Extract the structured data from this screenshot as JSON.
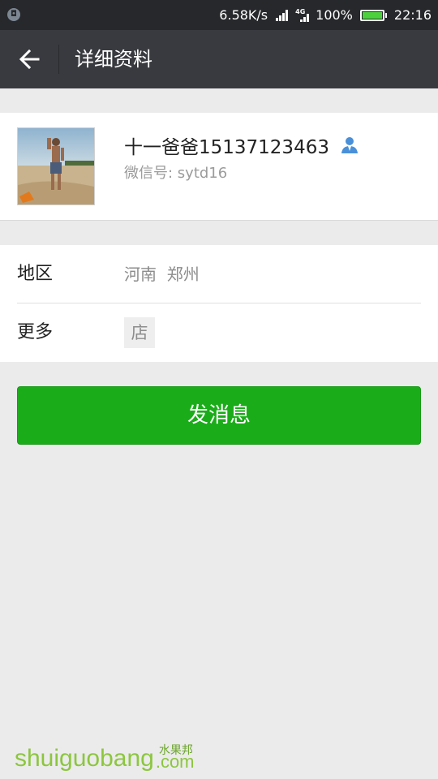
{
  "status_bar": {
    "net_speed": "6.58K/s",
    "network_type": "4G",
    "battery": "100%",
    "time": "22:16"
  },
  "header": {
    "title": "详细资料"
  },
  "profile": {
    "nickname": "十一爸爸15137123463",
    "wechat_id_label": "微信号: ",
    "wechat_id": "sytd16"
  },
  "details": {
    "region_label": "地区",
    "region_value": "河南  郑州",
    "more_label": "更多",
    "more_icon_text": "店"
  },
  "actions": {
    "send_message_label": "发消息"
  },
  "watermark": {
    "main": "shuiguobang",
    "cn": "水果邦",
    "suffix": ".com"
  },
  "colors": {
    "status_bar": "#26282b",
    "app_bar": "#393a3f",
    "background": "#ebebeb",
    "primary_button": "#1aad19",
    "contact_icon": "#4a90d9",
    "watermark": "#8cc63e"
  }
}
